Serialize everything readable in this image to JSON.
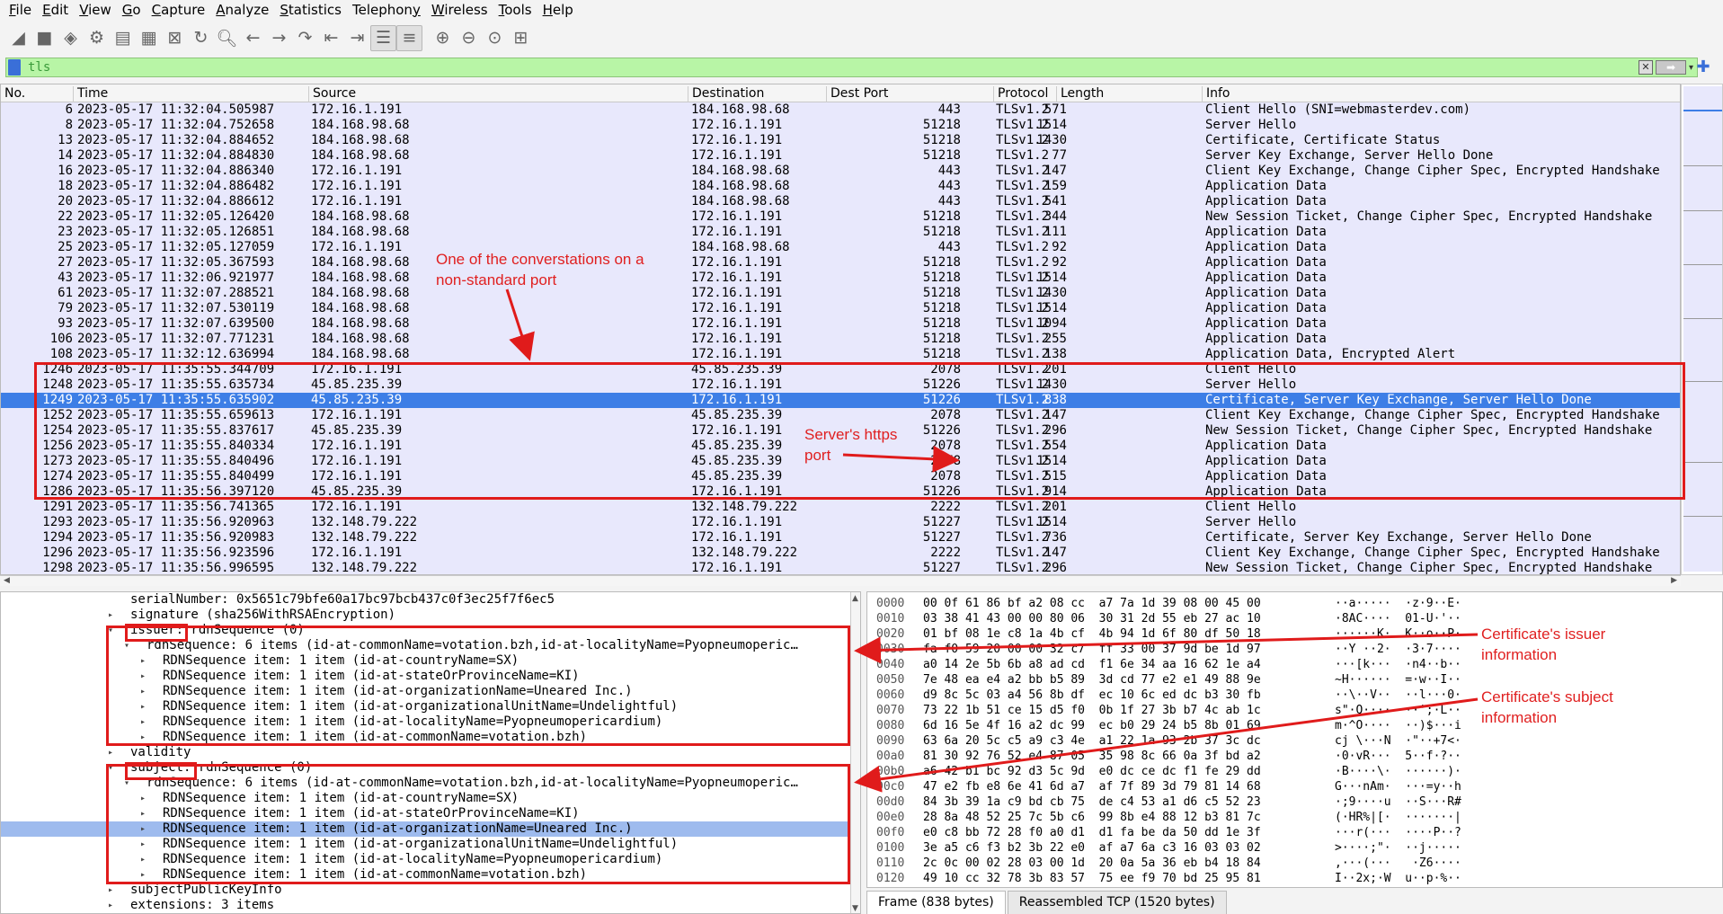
{
  "menu": [
    {
      "pre": "",
      "u": "F",
      "post": "ile"
    },
    {
      "pre": "",
      "u": "E",
      "post": "dit"
    },
    {
      "pre": "",
      "u": "V",
      "post": "iew"
    },
    {
      "pre": "",
      "u": "G",
      "post": "o"
    },
    {
      "pre": "",
      "u": "C",
      "post": "apture"
    },
    {
      "pre": "",
      "u": "A",
      "post": "nalyze"
    },
    {
      "pre": "",
      "u": "S",
      "post": "tatistics"
    },
    {
      "pre": "Telephon",
      "u": "y",
      "post": ""
    },
    {
      "pre": "",
      "u": "W",
      "post": "ireless"
    },
    {
      "pre": "",
      "u": "T",
      "post": "ools"
    },
    {
      "pre": "",
      "u": "H",
      "post": "elp"
    }
  ],
  "filter": {
    "value": "tls"
  },
  "columns": [
    "No.",
    "Time",
    "Source",
    "Destination",
    "Dest Port",
    "Protocol",
    "Length",
    "Info"
  ],
  "packets": [
    [
      "6",
      "2023-05-17 11:32:04.505987",
      "172.16.1.191",
      "184.168.98.68",
      "443",
      "TLSv1.2",
      "571",
      "Client Hello (SNI=webmasterdev.com)"
    ],
    [
      "8",
      "2023-05-17 11:32:04.752658",
      "184.168.98.68",
      "172.16.1.191",
      "51218",
      "TLSv1.2",
      "1514",
      "Server Hello"
    ],
    [
      "13",
      "2023-05-17 11:32:04.884652",
      "184.168.98.68",
      "172.16.1.191",
      "51218",
      "TLSv1.2",
      "1430",
      "Certificate, Certificate Status"
    ],
    [
      "14",
      "2023-05-17 11:32:04.884830",
      "184.168.98.68",
      "172.16.1.191",
      "51218",
      "TLSv1.2",
      "77",
      "Server Key Exchange, Server Hello Done"
    ],
    [
      "16",
      "2023-05-17 11:32:04.886340",
      "172.16.1.191",
      "184.168.98.68",
      "443",
      "TLSv1.2",
      "147",
      "Client Key Exchange, Change Cipher Spec, Encrypted Handshake"
    ],
    [
      "18",
      "2023-05-17 11:32:04.886482",
      "172.16.1.191",
      "184.168.98.68",
      "443",
      "TLSv1.2",
      "159",
      "Application Data"
    ],
    [
      "20",
      "2023-05-17 11:32:04.886612",
      "172.16.1.191",
      "184.168.98.68",
      "443",
      "TLSv1.2",
      "541",
      "Application Data"
    ],
    [
      "22",
      "2023-05-17 11:32:05.126420",
      "184.168.98.68",
      "172.16.1.191",
      "51218",
      "TLSv1.2",
      "344",
      "New Session Ticket, Change Cipher Spec, Encrypted Handshake"
    ],
    [
      "23",
      "2023-05-17 11:32:05.126851",
      "184.168.98.68",
      "172.16.1.191",
      "51218",
      "TLSv1.2",
      "111",
      "Application Data"
    ],
    [
      "25",
      "2023-05-17 11:32:05.127059",
      "172.16.1.191",
      "184.168.98.68",
      "443",
      "TLSv1.2",
      "92",
      "Application Data"
    ],
    [
      "27",
      "2023-05-17 11:32:05.367593",
      "184.168.98.68",
      "172.16.1.191",
      "51218",
      "TLSv1.2",
      "92",
      "Application Data"
    ],
    [
      "43",
      "2023-05-17 11:32:06.921977",
      "184.168.98.68",
      "172.16.1.191",
      "51218",
      "TLSv1.2",
      "1514",
      "Application Data"
    ],
    [
      "61",
      "2023-05-17 11:32:07.288521",
      "184.168.98.68",
      "172.16.1.191",
      "51218",
      "TLSv1.2",
      "1430",
      "Application Data"
    ],
    [
      "79",
      "2023-05-17 11:32:07.530119",
      "184.168.98.68",
      "172.16.1.191",
      "51218",
      "TLSv1.2",
      "1514",
      "Application Data"
    ],
    [
      "93",
      "2023-05-17 11:32:07.639500",
      "184.168.98.68",
      "172.16.1.191",
      "51218",
      "TLSv1.2",
      "1094",
      "Application Data"
    ],
    [
      "106",
      "2023-05-17 11:32:07.771231",
      "184.168.98.68",
      "172.16.1.191",
      "51218",
      "TLSv1.2",
      "255",
      "Application Data"
    ],
    [
      "108",
      "2023-05-17 11:32:12.636994",
      "184.168.98.68",
      "172.16.1.191",
      "51218",
      "TLSv1.2",
      "138",
      "Application Data, Encrypted Alert"
    ],
    [
      "1246",
      "2023-05-17 11:35:55.344709",
      "172.16.1.191",
      "45.85.235.39",
      "2078",
      "TLSv1.2",
      "201",
      "Client Hello"
    ],
    [
      "1248",
      "2023-05-17 11:35:55.635734",
      "45.85.235.39",
      "172.16.1.191",
      "51226",
      "TLSv1.2",
      "1430",
      "Server Hello"
    ],
    [
      "1249",
      "2023-05-17 11:35:55.635902",
      "45.85.235.39",
      "172.16.1.191",
      "51226",
      "TLSv1.2",
      "838",
      "Certificate, Server Key Exchange, Server Hello Done"
    ],
    [
      "1252",
      "2023-05-17 11:35:55.659613",
      "172.16.1.191",
      "45.85.235.39",
      "2078",
      "TLSv1.2",
      "147",
      "Client Key Exchange, Change Cipher Spec, Encrypted Handshake"
    ],
    [
      "1254",
      "2023-05-17 11:35:55.837617",
      "45.85.235.39",
      "172.16.1.191",
      "51226",
      "TLSv1.2",
      "296",
      "New Session Ticket, Change Cipher Spec, Encrypted Handshake"
    ],
    [
      "1256",
      "2023-05-17 11:35:55.840334",
      "172.16.1.191",
      "45.85.235.39",
      "2078",
      "TLSv1.2",
      "554",
      "Application Data"
    ],
    [
      "1273",
      "2023-05-17 11:35:55.840496",
      "172.16.1.191",
      "45.85.235.39",
      "2078",
      "TLSv1.2",
      "1514",
      "Application Data"
    ],
    [
      "1274",
      "2023-05-17 11:35:55.840499",
      "172.16.1.191",
      "45.85.235.39",
      "2078",
      "TLSv1.2",
      "515",
      "Application Data"
    ],
    [
      "1286",
      "2023-05-17 11:35:56.397120",
      "45.85.235.39",
      "172.16.1.191",
      "51226",
      "TLSv1.2",
      "914",
      "Application Data"
    ],
    [
      "1291",
      "2023-05-17 11:35:56.741365",
      "172.16.1.191",
      "132.148.79.222",
      "2222",
      "TLSv1.2",
      "201",
      "Client Hello"
    ],
    [
      "1293",
      "2023-05-17 11:35:56.920963",
      "132.148.79.222",
      "172.16.1.191",
      "51227",
      "TLSv1.2",
      "1514",
      "Server Hello"
    ],
    [
      "1294",
      "2023-05-17 11:35:56.920983",
      "132.148.79.222",
      "172.16.1.191",
      "51227",
      "TLSv1.2",
      "736",
      "Certificate, Server Key Exchange, Server Hello Done"
    ],
    [
      "1296",
      "2023-05-17 11:35:56.923596",
      "172.16.1.191",
      "132.148.79.222",
      "2222",
      "TLSv1.2",
      "147",
      "Client Key Exchange, Change Cipher Spec, Encrypted Handshake"
    ],
    [
      "1298",
      "2023-05-17 11:35:56.996595",
      "132.148.79.222",
      "172.16.1.191",
      "51227",
      "TLSv1.2",
      "296",
      "New Session Ticket, Change Cipher Spec, Encrypted Handshake"
    ]
  ],
  "selected_packet": "1249",
  "details": [
    {
      "indent": 0,
      "tw": "",
      "text": "serialNumber: 0x5651c79bfe60a17bc97bcb437c0f3ec25f7f6ec5"
    },
    {
      "indent": 0,
      "tw": "▸",
      "text": "signature (sha256WithRSAEncryption)"
    },
    {
      "indent": 0,
      "tw": "▾",
      "text": "issuer: rdnSequence (0)"
    },
    {
      "indent": 1,
      "tw": "▾",
      "text": "rdnSequence: 6 items (id-at-commonName=votation.bzh,id-at-localityName=Pyopneumoperic…"
    },
    {
      "indent": 2,
      "tw": "▸",
      "text": "RDNSequence item: 1 item (id-at-countryName=SX)"
    },
    {
      "indent": 2,
      "tw": "▸",
      "text": "RDNSequence item: 1 item (id-at-stateOrProvinceName=KI)"
    },
    {
      "indent": 2,
      "tw": "▸",
      "text": "RDNSequence item: 1 item (id-at-organizationName=Uneared Inc.)"
    },
    {
      "indent": 2,
      "tw": "▸",
      "text": "RDNSequence item: 1 item (id-at-organizationalUnitName=Undelightful)"
    },
    {
      "indent": 2,
      "tw": "▸",
      "text": "RDNSequence item: 1 item (id-at-localityName=Pyopneumopericardium)"
    },
    {
      "indent": 2,
      "tw": "▸",
      "text": "RDNSequence item: 1 item (id-at-commonName=votation.bzh)"
    },
    {
      "indent": 0,
      "tw": "▸",
      "text": "validity"
    },
    {
      "indent": 0,
      "tw": "▾",
      "text": "subject: rdnSequence (0)"
    },
    {
      "indent": 1,
      "tw": "▾",
      "text": "rdnSequence: 6 items (id-at-commonName=votation.bzh,id-at-localityName=Pyopneumoperic…"
    },
    {
      "indent": 2,
      "tw": "▸",
      "text": "RDNSequence item: 1 item (id-at-countryName=SX)"
    },
    {
      "indent": 2,
      "tw": "▸",
      "text": "RDNSequence item: 1 item (id-at-stateOrProvinceName=KI)"
    },
    {
      "indent": 2,
      "tw": "▸",
      "text": "RDNSequence item: 1 item (id-at-organizationName=Uneared Inc.)",
      "hl": true
    },
    {
      "indent": 2,
      "tw": "▸",
      "text": "RDNSequence item: 1 item (id-at-organizationalUnitName=Undelightful)"
    },
    {
      "indent": 2,
      "tw": "▸",
      "text": "RDNSequence item: 1 item (id-at-localityName=Pyopneumopericardium)"
    },
    {
      "indent": 2,
      "tw": "▸",
      "text": "RDNSequence item: 1 item (id-at-commonName=votation.bzh)"
    },
    {
      "indent": 0,
      "tw": "▸",
      "text": "subjectPublicKeyInfo"
    },
    {
      "indent": 0,
      "tw": "▸",
      "text": "extensions: 3 items"
    }
  ],
  "bytes": [
    [
      "0000",
      "00 0f 61 86 bf a2 08 cc  a7 7a 1d 39 08 00 45 00",
      "··a·····  ·z·9··E·"
    ],
    [
      "0010",
      "03 38 41 43 00 00 80 06  30 31 2d 55 eb 27 ac 10",
      "·8AC····  01-U·'··"
    ],
    [
      "0020",
      "01 bf 08 1e c8 1a 4b cf  4b 94 1d 6f 80 df 50 18",
      "······K·  K··o··P·"
    ],
    [
      "0030",
      "fa f0 59 20 00 00 32 c7  ff 33 00 37 9d be 1d 97",
      "··Y ··2·  ·3·7····"
    ],
    [
      "0040",
      "a0 14 2e 5b 6b a8 ad cd  f1 6e 34 aa 16 62 1e a4",
      "···[k···  ·n4··b··"
    ],
    [
      "0050",
      "7e 48 ea e4 a2 bb b5 89  3d cd 77 e2 e1 49 88 9e",
      "~H······  =·w··I··"
    ],
    [
      "0060",
      "d9 8c 5c 03 a4 56 8b df  ec 10 6c ed dc b3 30 fb",
      "··\\··V··  ··l···0·"
    ],
    [
      "0070",
      "73 22 1b 51 ce 15 d5 f0  0b 1f 27 3b b7 4c ab 1c",
      "s\"·Q····  ··';·L··"
    ],
    [
      "0080",
      "6d 16 5e 4f 16 a2 dc 99  ec b0 29 24 b5 8b 01 69",
      "m·^O····  ··)$···i"
    ],
    [
      "0090",
      "63 6a 20 5c c5 a9 c3 4e  a1 22 1a 93 2b 37 3c dc",
      "cj \\···N  ·\"··+7<·"
    ],
    [
      "00a0",
      "81 30 92 76 52 e4 87 05  35 98 8c 66 0a 3f bd a2",
      "·0·vR···  5··f·?··"
    ],
    [
      "00b0",
      "a6 42 b1 bc 92 d3 5c 9d  e0 dc ce dc f1 fe 29 dd",
      "·B····\\·  ······)·"
    ],
    [
      "00c0",
      "47 e2 fb e8 6e 41 6d a7  af 7f 89 3d 79 81 14 68",
      "G···nAm·  ···=y··h"
    ],
    [
      "00d0",
      "84 3b 39 1a c9 bd cb 75  de c4 53 a1 d6 c5 52 23",
      "·;9····u  ··S···R#"
    ],
    [
      "00e0",
      "28 8a 48 52 25 7c 5b c6  99 8b e4 88 12 b3 81 7c",
      "(·HR%|[·  ·······|"
    ],
    [
      "00f0",
      "e0 c8 bb 72 28 f0 a0 d1  d1 fa be da 50 dd 1e 3f",
      "···r(···  ····P··?"
    ],
    [
      "0100",
      "3e a5 c6 f3 b2 3b 22 e0  af a7 6a c3 16 03 03 02",
      ">····;\"·  ··j·····"
    ],
    [
      "0110",
      "2c 0c 00 02 28 03 00 1d  20 0a 5a 36 eb b4 18 84",
      ",···(···   ·Z6····"
    ],
    [
      "0120",
      "49 10 cc 32 78 3b 83 57  75 ee f9 70 bd 25 95 81",
      "I··2x;·W  u··p·%··"
    ]
  ],
  "byte_tabs": [
    "Frame (838 bytes)",
    "Reassembled TCP (1520 bytes)"
  ],
  "annotations": {
    "port_note": "One of the converstations on a\nnon-standard port",
    "https_port": "Server's https\nport",
    "issuer_note": "Certificate's issuer\ninformation",
    "subject_note": "Certificate's subject\ninformation"
  },
  "colors": {
    "row_bg": "#e8e8fc",
    "selected": "#3d7ee6",
    "highlight": "#9ebbee",
    "filter_ok": "#b8f5a6",
    "annot": "#e01b1b"
  }
}
